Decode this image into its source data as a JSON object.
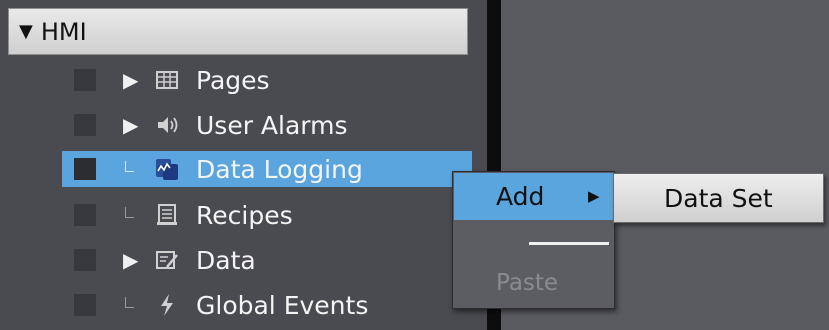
{
  "tree": {
    "header": {
      "label": "HMI",
      "expand_icon": "triangle-down"
    },
    "items": [
      {
        "label": "Pages",
        "icon": "pages-grid-icon",
        "has_children": true
      },
      {
        "label": "User Alarms",
        "icon": "speaker-alarm-icon",
        "has_children": true
      },
      {
        "label": "Data Logging",
        "icon": "data-logging-icon",
        "has_children": false,
        "selected": true
      },
      {
        "label": "Recipes",
        "icon": "recipes-book-icon",
        "has_children": false
      },
      {
        "label": "Data",
        "icon": "data-edit-icon",
        "has_children": true
      },
      {
        "label": "Global Events",
        "icon": "lightning-icon",
        "has_children": false
      }
    ]
  },
  "context_menu": {
    "items": [
      {
        "label": "Add",
        "has_submenu": true,
        "highlighted": true
      },
      {
        "label": "Paste",
        "enabled": false
      }
    ]
  },
  "submenu": {
    "items": [
      {
        "label": "Data Set"
      }
    ]
  },
  "colors": {
    "selection": "#5aa5dd",
    "panel": "#4a4b50",
    "menu": "#5c5d63"
  }
}
